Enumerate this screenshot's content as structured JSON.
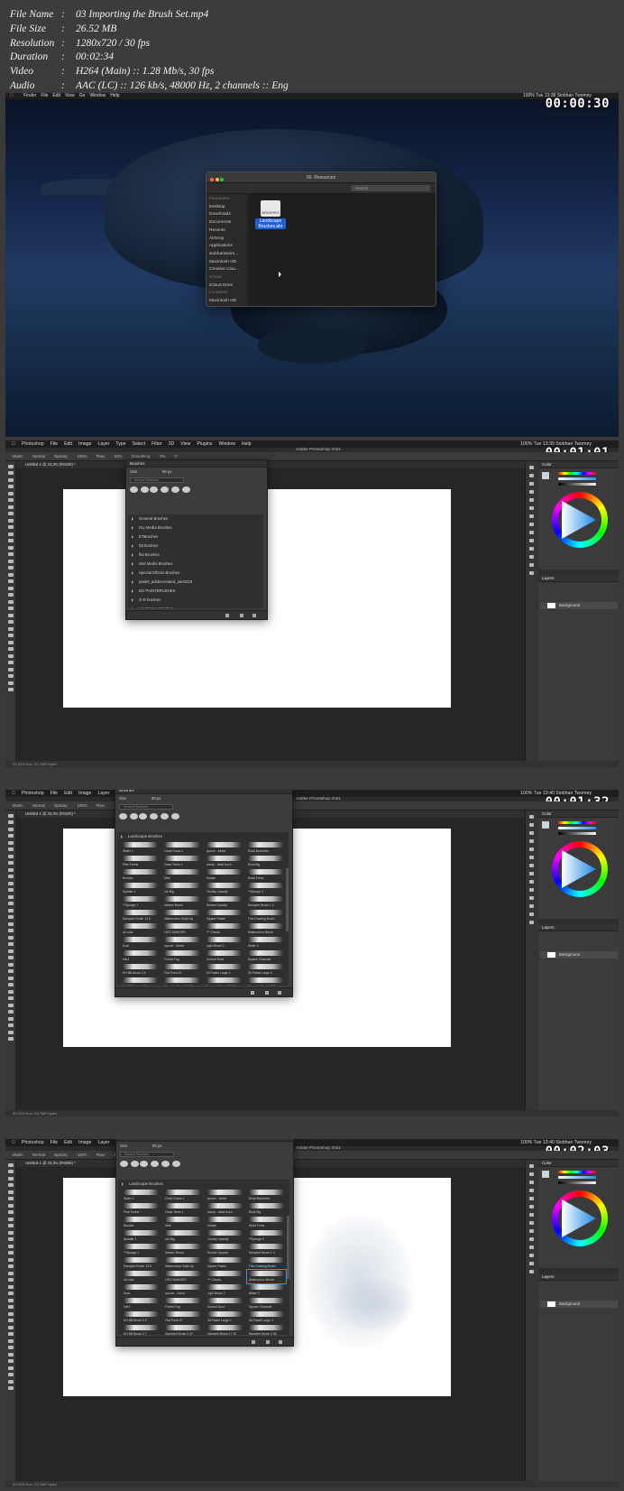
{
  "meta": [
    {
      "key": "File Name",
      "value": "03 Importing the Brush Set.mp4"
    },
    {
      "key": "File Size",
      "value": "26.52 MB"
    },
    {
      "key": "Resolution",
      "value": "1280x720 / 30 fps"
    },
    {
      "key": "Duration",
      "value": "00:02:34"
    },
    {
      "key": "Video",
      "value": "H264 (Main) :: 1.28 Mb/s, 30 fps"
    },
    {
      "key": "Audio",
      "value": "AAC (LC) :: 126 kb/s, 48000 Hz, 2 channels :: Eng"
    }
  ],
  "frames": [
    {
      "timestamp": "00:00:30",
      "mac_menu": [
        "Finder",
        "File",
        "Edit",
        "View",
        "Go",
        "Window",
        "Help"
      ],
      "status": "100%  Tue 13:38   Siobhan Twomey",
      "finder": {
        "path": "00. Resources",
        "search_placeholder": "Search",
        "sidebar": [
          {
            "label": "Favourites",
            "section": true
          },
          {
            "label": "Desktop"
          },
          {
            "label": "Downloads"
          },
          {
            "label": "Documents"
          },
          {
            "label": "Recents"
          },
          {
            "label": "AirDrop"
          },
          {
            "label": "Applications"
          },
          {
            "label": "siobhantwom..."
          },
          {
            "label": "Macintosh HD"
          },
          {
            "label": "Creative Clou..."
          },
          {
            "label": "iCloud",
            "section": true
          },
          {
            "label": "iCloud Drive"
          },
          {
            "label": "Locations",
            "section": true
          },
          {
            "label": "Macintosh HD"
          }
        ],
        "file_icon_text": "BRUSHES",
        "file_label": "Landscape Brushes.abr"
      }
    },
    {
      "timestamp": "00:01:01",
      "status": "100%  Tue 13:39   Siobhan Twomey",
      "brush_folders": [
        "General Brushes",
        "Dry Media Brushes",
        "ETBrushes",
        "fat brushes",
        "flat Brushes",
        "Wet Media Brushes",
        "Special Effects Brushes",
        "pastel_adobecreated_Jan2019",
        "BG PAINTBRUSHES",
        "G-R brushes",
        "Landscape Brushes"
      ]
    },
    {
      "timestamp": "00:01:32",
      "status": "100%  Tue 13:40   Siobhan Twomey",
      "open_folder": "Landscape Brushes"
    },
    {
      "timestamp": "00:02:03",
      "status": "100%  Tue 13:40   Siobhan Twomey",
      "open_folder": "Landscape Brushes"
    }
  ],
  "photoshop": {
    "menu": [
      "Photoshop",
      "File",
      "Edit",
      "Image",
      "Layer",
      "Type",
      "Select",
      "Filter",
      "3D",
      "View",
      "Plugins",
      "Window",
      "Help"
    ],
    "app_title": "Adobe Photoshop 2021",
    "options": [
      "Mode:",
      "Normal",
      "Opacity:",
      "100%",
      "Flow:",
      "63%",
      "Smoothing:",
      "0%",
      "0°"
    ],
    "doc_tab": "Untitled-1 @ 33,3% (RGB/8) *",
    "status": "33,33%    Doc: 23,7M/0 bytes",
    "brushes_panel_title": "Brushes",
    "size_label": "Size",
    "size_value": "90 px",
    "search_placeholder": "Search Brushes",
    "color_panel_title": "Color",
    "layers_panel_title": "Layers",
    "layer_name": "Background"
  },
  "brush_names": [
    "Water 1",
    "Dune Grass 1",
    "spruce - forest",
    "Dead Branches",
    "Pine Forest",
    "Dead Trees 1",
    "stamp - dead bush",
    "Rock Big",
    "Bushes",
    "Mist",
    "Smoke",
    "Dead Trees",
    "Splatter 1",
    "Ink Big",
    "Chunky Opacity",
    "**Sponge 2",
    "**Sponge 1",
    "Marker Brush",
    "Texture Opacity",
    "Sampled Brush 1 4",
    "Sampled Brush 13 8",
    "Watercolour Build Up",
    "Square Pastel",
    "Thin Drawing Brush",
    "oil color",
    "HEG WANGER",
    "*** Clouds",
    "Watercolour Brush",
    "Dust",
    "spruce - forest",
    "Light Beam 2",
    "Water 3",
    "Inkr1",
    "Forest Fog",
    "Ground Dust",
    "Square Charcoal",
    "KH BB Brush 3 5",
    "Flat Point 10",
    "Oil Pastel Large 2",
    "Oil Pastel Large 3",
    "KH BB Brush 3 7",
    "Sampled Brush 9 47",
    "Sampled Brush 17 30",
    "Sampled Brush 3 38",
    "Sampled Brush 2 31",
    "Sampled Brush 3 2",
    "Sampled Brush 33 6",
    "Sampled Brush 53 7"
  ],
  "colors": {
    "accent": "#1f5fd6",
    "ps_bg": "#2b2b2b",
    "panel": "#3c3c3c"
  }
}
